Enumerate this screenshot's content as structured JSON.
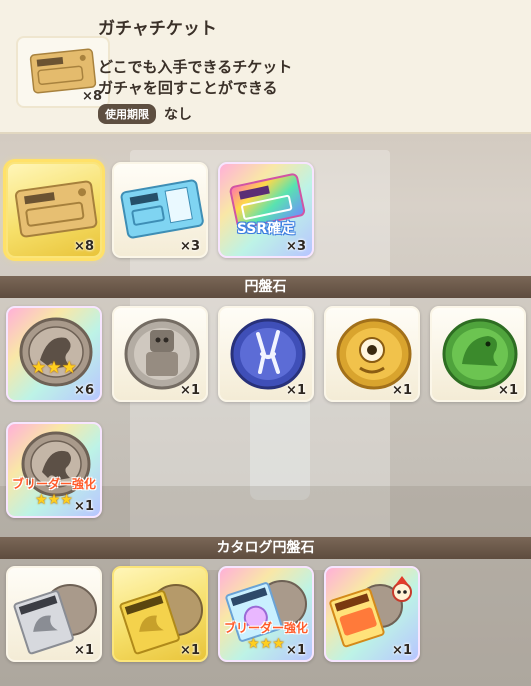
{
  "detail": {
    "title": "ガチャチケット",
    "description_line1": "どこでも入手できるチケット",
    "description_line2": "ガチャを回すことができる",
    "expiry_label": "使用期限",
    "expiry_value": "なし",
    "quantity": "×8"
  },
  "tickets": [
    {
      "name": "gacha-ticket",
      "quantity": "×8"
    },
    {
      "name": "blue-ticket",
      "quantity": "×3"
    },
    {
      "name": "ssr-ticket",
      "quantity": "×3",
      "badge": "SSR確定"
    }
  ],
  "sections": {
    "enbanseki": "円盤石",
    "catalog_enbanseki": "カタログ円盤石"
  },
  "enbanseki": [
    {
      "name": "lion-disc",
      "quantity": "×6",
      "stars": "★★★"
    },
    {
      "name": "robot-disc",
      "quantity": "×1"
    },
    {
      "name": "rabbit-disc",
      "quantity": "×1"
    },
    {
      "name": "cyclops-disc",
      "quantity": "×1"
    },
    {
      "name": "dragon-disc",
      "quantity": "×1"
    },
    {
      "name": "breeder-disc",
      "quantity": "×1",
      "badge": "ブリーダー強化",
      "stars": "★★★"
    }
  ],
  "catalog": [
    {
      "name": "catalog-silver",
      "quantity": "×1"
    },
    {
      "name": "catalog-gold",
      "quantity": "×1"
    },
    {
      "name": "catalog-breeder",
      "quantity": "×1",
      "badge": "ブリーダー強化",
      "stars": "★★★"
    },
    {
      "name": "catalog-rainbow",
      "quantity": "×1"
    }
  ],
  "colors": {
    "section_bg": "#6b5747",
    "selected_glow": "#ffe169",
    "badge_orange": "#ff5b2a",
    "star_gold": "#ffcf1f"
  }
}
